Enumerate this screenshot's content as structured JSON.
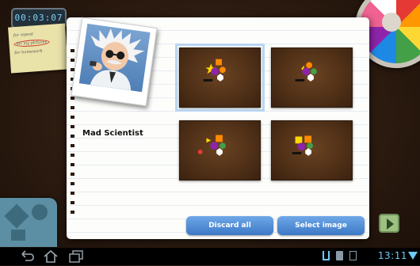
{
  "background": {
    "timer": "00:03:07",
    "sticky_note": [
      "for repeat",
      "for my pictures",
      "for homework"
    ]
  },
  "dialog": {
    "avatar_label": "Mad Scientist",
    "selected_index": 0,
    "buttons": {
      "discard": "Discard all",
      "select": "Select image"
    }
  },
  "status_bar": {
    "time": "13:11",
    "icons": [
      "usb-icon",
      "sd-card-icon",
      "image-icon",
      "wifi-icon"
    ]
  },
  "colors": {
    "button_top": "#6fa8e8",
    "button_bottom": "#3c78c6",
    "selection": "#b9d6f3",
    "clock": "#6ec8f5"
  }
}
